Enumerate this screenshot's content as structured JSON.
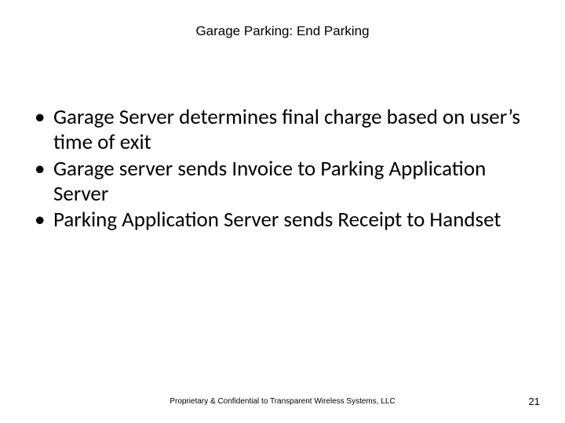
{
  "title": "Garage Parking: End Parking",
  "bullets": [
    "Garage Server determines final charge based on user’s time of exit",
    "Garage server sends Invoice to Parking Application Server",
    "Parking Application  Server sends Receipt to Handset"
  ],
  "footer": "Proprietary & Confidential to Transparent Wireless Systems, LLC",
  "page_number": "21"
}
